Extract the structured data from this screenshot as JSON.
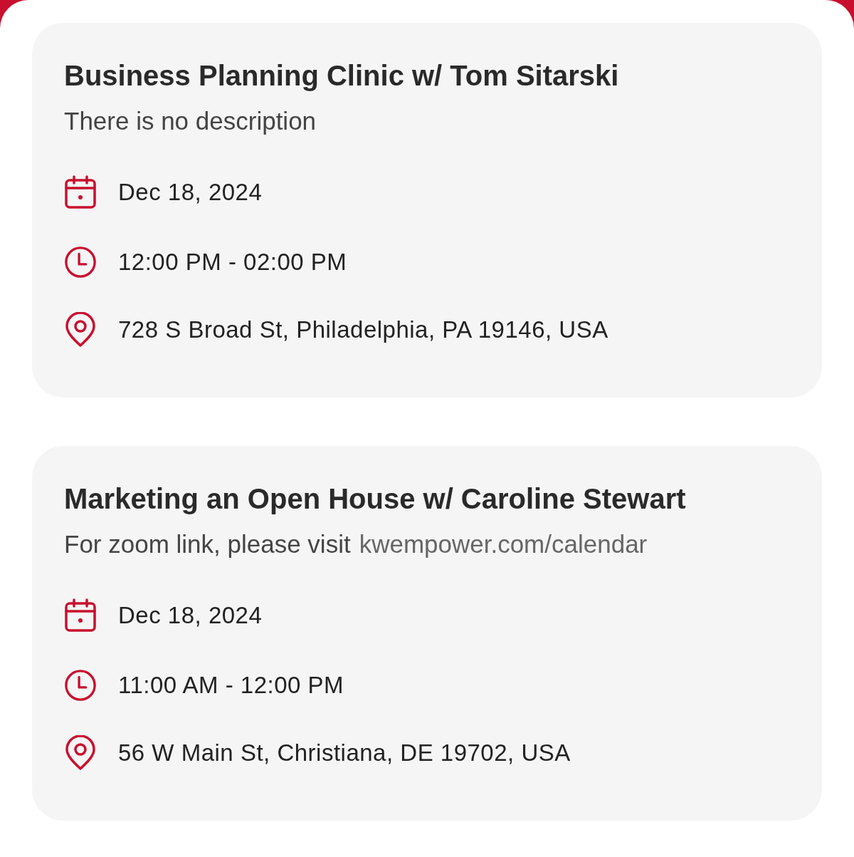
{
  "events": [
    {
      "title": "Business Planning Clinic w/ Tom Sitarski",
      "description": "There is no description",
      "date": "Dec 18, 2024",
      "time": "12:00 PM - 02:00 PM",
      "location": "728 S Broad St, Philadelphia, PA 19146, USA"
    },
    {
      "title": "Marketing an Open House w/ Caroline Stewart",
      "description": "For zoom link, please visit",
      "link": "kwempower.com/calendar",
      "date": "Dec 18, 2024",
      "time": "11:00 AM - 12:00 PM",
      "location": "56 W Main St, Christiana, DE 19702, USA"
    }
  ]
}
